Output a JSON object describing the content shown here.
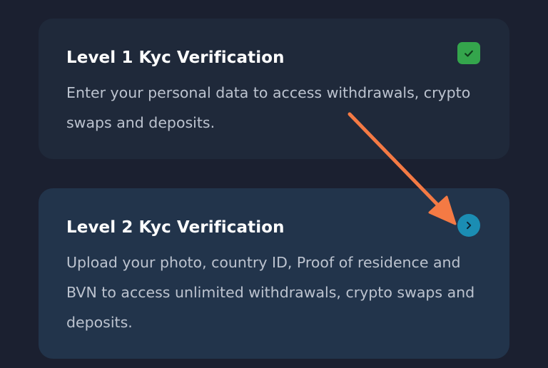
{
  "levels": [
    {
      "title": "Level 1 Kyc Verification",
      "description": "Enter your personal data to access withdrawals, crypto swaps and deposits.",
      "status_icon": "checkmark-icon",
      "status_color": "#34a54c"
    },
    {
      "title": "Level 2 Kyc Verification",
      "description": "Upload your photo, country ID, Proof of residence and BVN to access unlimited withdrawals, crypto swaps and deposits.",
      "action_icon": "chevron-right-icon",
      "action_color": "#1b8db3"
    }
  ],
  "colors": {
    "background": "#1b2030",
    "card_level1": "#1f293a",
    "card_level2": "#22344b",
    "annotation_arrow": "#f47a44"
  }
}
